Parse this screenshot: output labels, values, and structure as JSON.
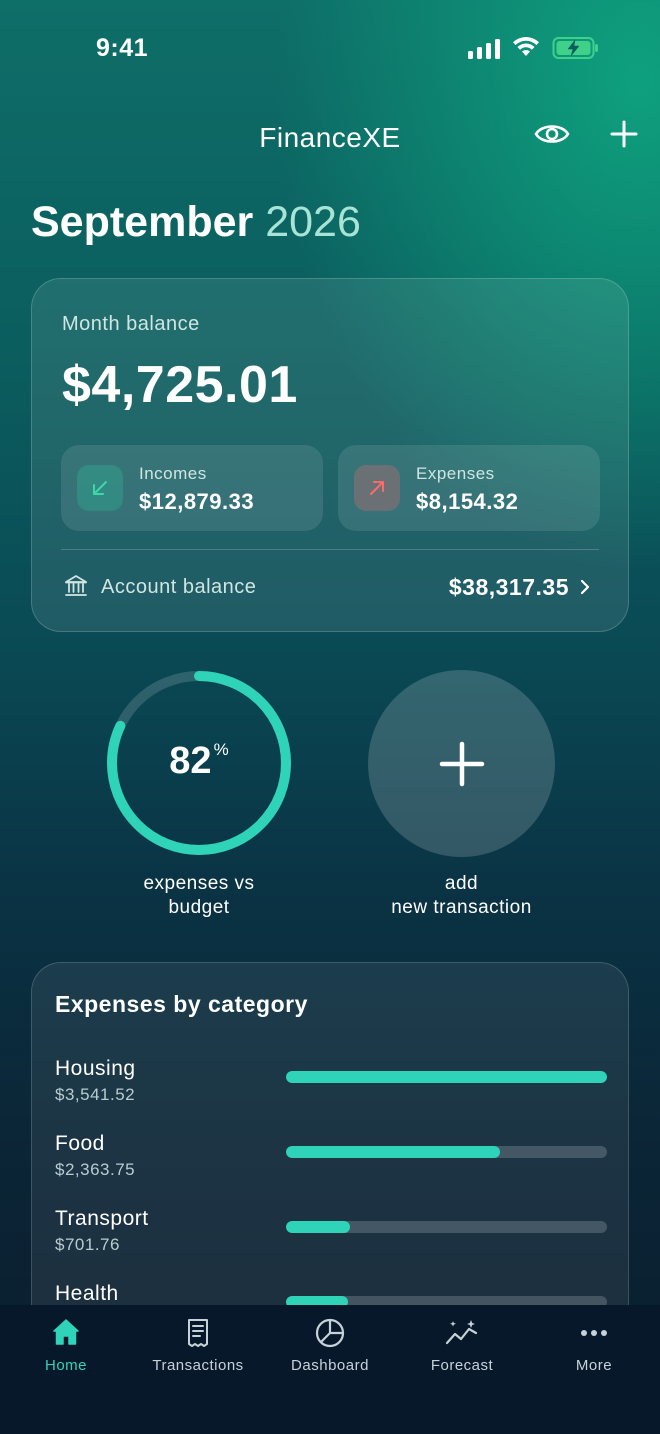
{
  "status_bar": {
    "time": "9:41"
  },
  "header": {
    "title": "FinanceXE"
  },
  "period": {
    "month": "September",
    "year": "2026"
  },
  "balance_card": {
    "month_balance_label": "Month balance",
    "month_balance_value": "$4,725.01",
    "incomes": {
      "label": "Incomes",
      "value": "$12,879.33"
    },
    "expenses": {
      "label": "Expenses",
      "value": "$8,154.32"
    },
    "account_balance_label": "Account balance",
    "account_balance_value": "$38,317.35"
  },
  "budget_ring": {
    "percent": 82,
    "percent_value": "82",
    "percent_unit": "%",
    "caption_line1": "expenses vs",
    "caption_line2": "budget"
  },
  "add_transaction": {
    "caption_line1": "add",
    "caption_line2": "new transaction"
  },
  "categories": {
    "title": "Expenses by category",
    "items": [
      {
        "name": "Housing",
        "amount": "$3,541.52",
        "fill": 1.0
      },
      {
        "name": "Food",
        "amount": "$2,363.75",
        "fill": 0.667
      },
      {
        "name": "Transport",
        "amount": "$701.76",
        "fill": 0.198
      },
      {
        "name": "Health",
        "amount": "",
        "fill": 0.193
      }
    ]
  },
  "tab_bar": {
    "items": [
      {
        "label": "Home",
        "icon": "home-icon",
        "active": true
      },
      {
        "label": "Transactions",
        "icon": "receipt-icon",
        "active": false
      },
      {
        "label": "Dashboard",
        "icon": "pie-chart-icon",
        "active": false
      },
      {
        "label": "Forecast",
        "icon": "sparkle-trend-icon",
        "active": false
      },
      {
        "label": "More",
        "icon": "more-dots-icon",
        "active": false
      }
    ]
  },
  "colors": {
    "accent": "#2fd3b8",
    "income_icon": "#3fd6a8",
    "expense_icon": "#ff6b6b",
    "tab_bar_bg": "#07182a"
  }
}
